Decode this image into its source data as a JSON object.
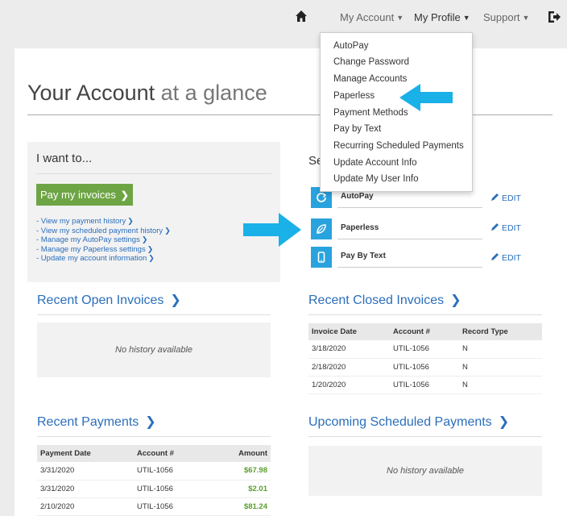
{
  "nav": {
    "my_account": "My Account",
    "my_profile": "My Profile",
    "support": "Support"
  },
  "dropdown": {
    "items": [
      "AutoPay",
      "Change Password",
      "Manage Accounts",
      "Paperless",
      "Payment Methods",
      "Pay by Text",
      "Recurring Scheduled Payments",
      "Update Account Info",
      "Update My User Info"
    ]
  },
  "page": {
    "title_main": "Your Account",
    "title_light": " at a glance"
  },
  "iwant": {
    "title": "I want to...",
    "pay_button": "Pay my invoices",
    "links": [
      "- View my payment history",
      "- View my scheduled payment history",
      "- Manage my AutoPay settings",
      "- Manage my Paperless settings",
      "- Update my account information"
    ]
  },
  "settings": {
    "title": "Se",
    "rows": [
      {
        "label": "AutoPay",
        "icon": "refresh-icon",
        "edit": "EDIT"
      },
      {
        "label": "Paperless",
        "icon": "leaf-icon",
        "edit": "EDIT"
      },
      {
        "label": "Pay By Text",
        "icon": "phone-icon",
        "edit": "EDIT"
      }
    ]
  },
  "open_invoices": {
    "title": "Recent Open Invoices",
    "empty": "No history available"
  },
  "closed_invoices": {
    "title": "Recent Closed Invoices",
    "headers": [
      "Invoice Date",
      "Account #",
      "Record Type"
    ],
    "rows": [
      [
        "3/18/2020",
        "UTIL-1056",
        "N"
      ],
      [
        "2/18/2020",
        "UTIL-1056",
        "N"
      ],
      [
        "1/20/2020",
        "UTIL-1056",
        "N"
      ]
    ]
  },
  "payments": {
    "title": "Recent Payments",
    "headers": [
      "Payment Date",
      "Account #",
      "Amount"
    ],
    "rows": [
      [
        "3/31/2020",
        "UTIL-1056",
        "$67.98"
      ],
      [
        "3/31/2020",
        "UTIL-1056",
        "$2.01"
      ],
      [
        "2/10/2020",
        "UTIL-1056",
        "$81.24"
      ]
    ]
  },
  "scheduled": {
    "title": "Upcoming Scheduled Payments",
    "empty": "No history available"
  },
  "colors": {
    "accent_blue": "#2a6ebb",
    "icon_blue": "#29a3de",
    "pay_green": "#6da544",
    "arrow_blue": "#1ab0e8"
  }
}
